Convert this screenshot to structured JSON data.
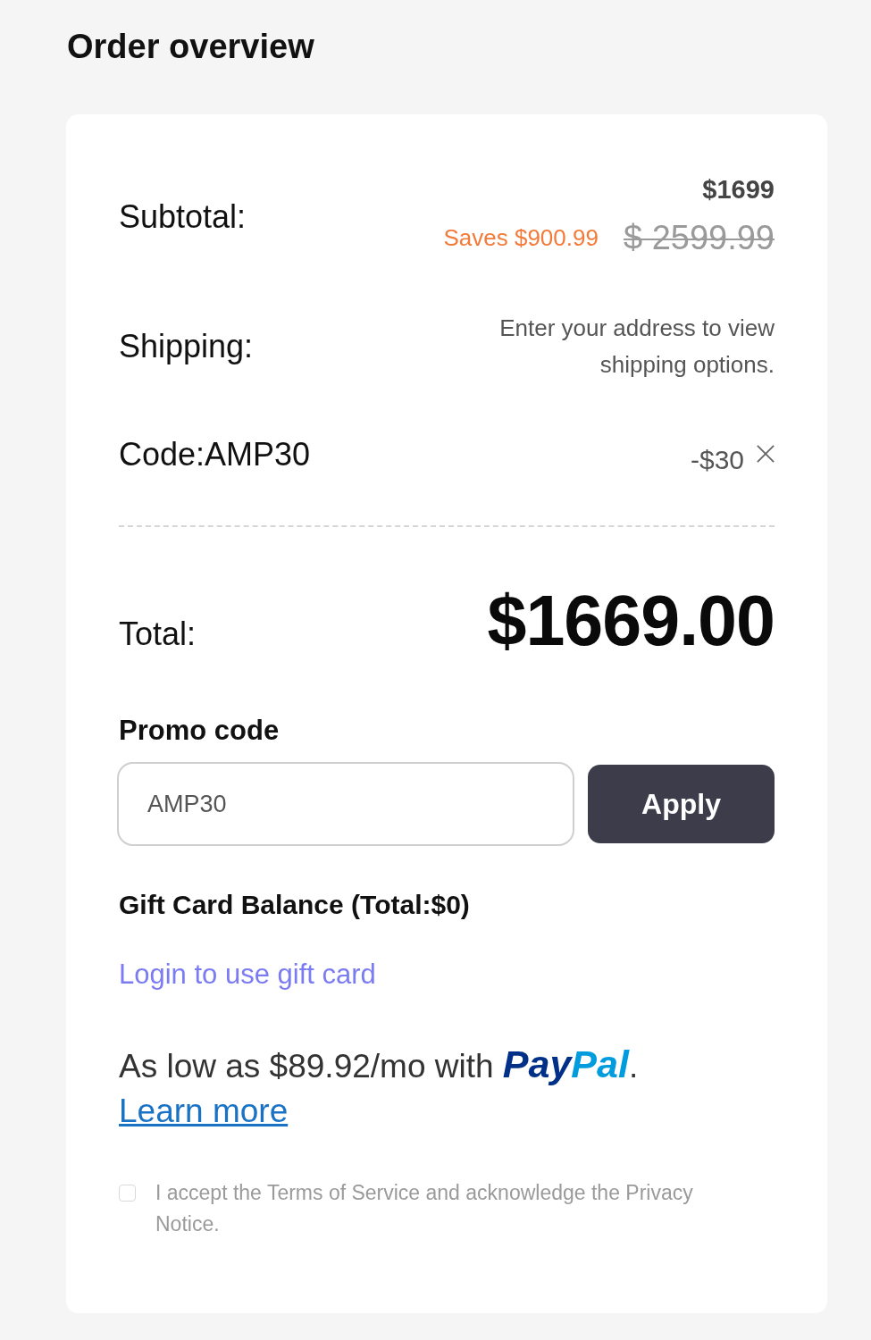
{
  "title": "Order overview",
  "summary": {
    "subtotal": {
      "label": "Subtotal:",
      "price": "$1699",
      "savings": "Saves $900.99",
      "original_price": "$ 2599.99"
    },
    "shipping": {
      "label": "Shipping:",
      "note": "Enter your address to view shipping options."
    },
    "code": {
      "label": "Code:AMP30",
      "discount": "-$30"
    },
    "total": {
      "label": "Total:",
      "amount": "$1669.00"
    }
  },
  "promo": {
    "label": "Promo code",
    "value": "AMP30",
    "button": "Apply"
  },
  "gift_card": {
    "balance": "Gift Card Balance (Total:$0)",
    "login_link": "Login to use gift card"
  },
  "financing": {
    "text": "As low as $89.92/mo with",
    "logo": [
      "Pay",
      "Pal"
    ],
    "end": ".",
    "link": "Learn more"
  },
  "terms": {
    "checked": false,
    "text": "I accept the Terms of Service and acknowledge the Privacy Notice."
  }
}
